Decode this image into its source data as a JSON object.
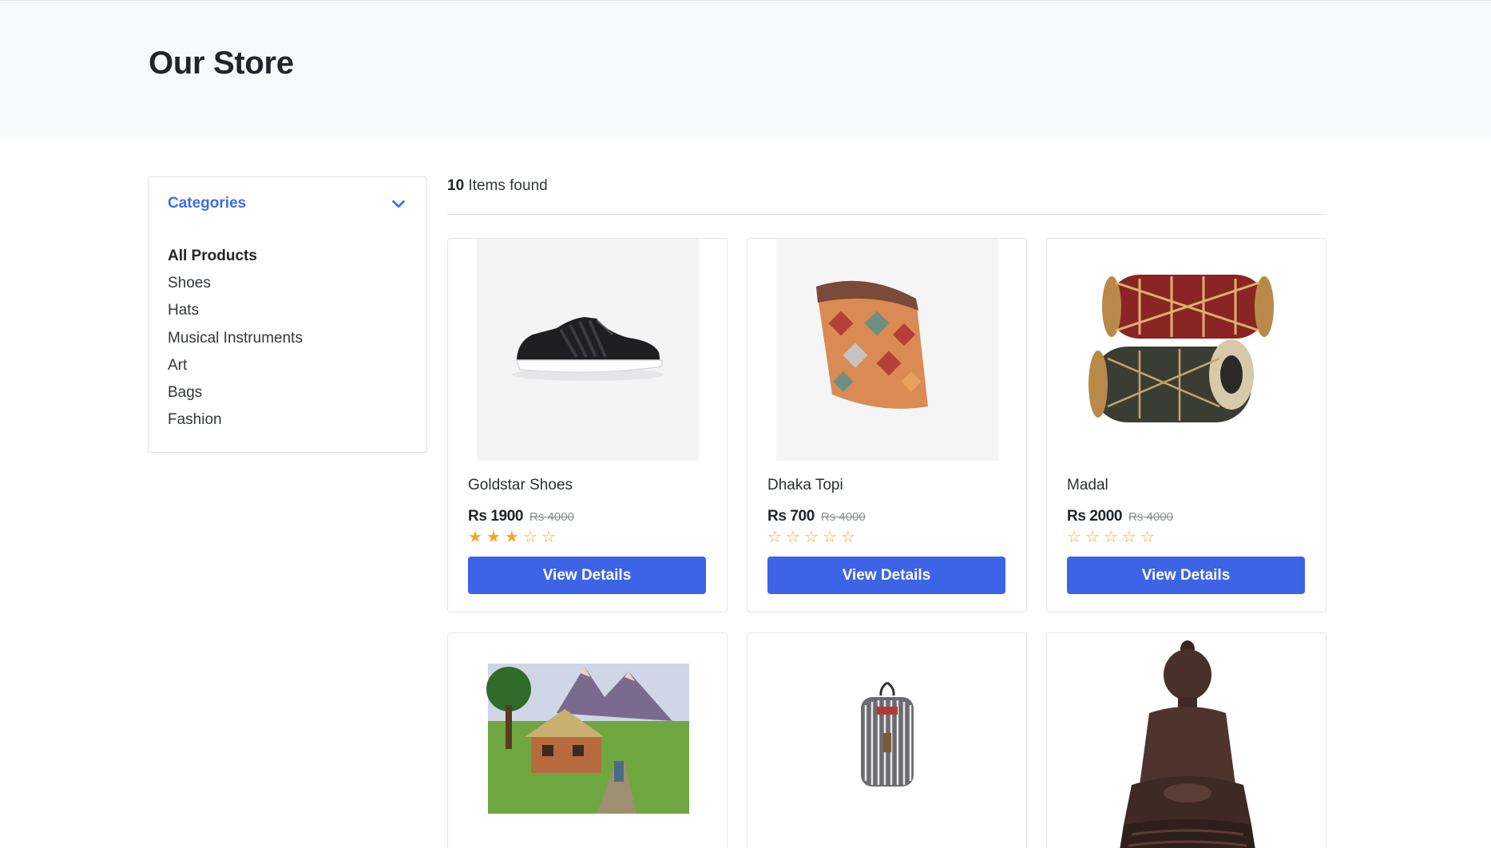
{
  "page": {
    "title": "Our Store"
  },
  "sidebar": {
    "title": "Categories",
    "toggle_icon": "chevron-down-icon",
    "items": [
      {
        "label": "All Products",
        "active": true
      },
      {
        "label": "Shoes"
      },
      {
        "label": "Hats"
      },
      {
        "label": "Musical Instruments"
      },
      {
        "label": "Art"
      },
      {
        "label": "Bags"
      },
      {
        "label": "Fashion"
      }
    ]
  },
  "results": {
    "count": "10",
    "suffix": "Items found"
  },
  "colors": {
    "accent": "#3d6ee8",
    "button": "#3d63e6",
    "star": "#f5a623",
    "hero_bg": "#f8f9fa"
  },
  "products": [
    {
      "name": "Goldstar Shoes",
      "price": "Rs 1900",
      "old_price": "Rs 4000",
      "rating": 3,
      "button": "View Details",
      "image": "sneaker"
    },
    {
      "name": "Dhaka Topi",
      "price": "Rs 700",
      "old_price": "Rs 4000",
      "rating": 0,
      "button": "View Details",
      "image": "dhaka-topi"
    },
    {
      "name": "Madal",
      "price": "Rs 2000",
      "old_price": "Rs 4000",
      "rating": 0,
      "button": "View Details",
      "image": "madal-drums"
    },
    {
      "image": "landscape-painting"
    },
    {
      "image": "backpack"
    },
    {
      "image": "buddha-statue"
    }
  ]
}
